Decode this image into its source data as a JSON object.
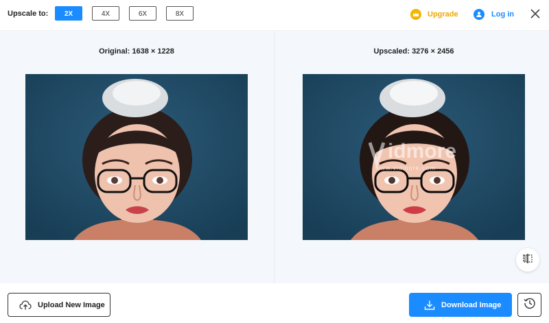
{
  "header": {
    "upscale_label": "Upscale to:",
    "scale_options": [
      "2X",
      "4X",
      "6X",
      "8X"
    ],
    "selected_scale": "2X",
    "upgrade_label": "Upgrade",
    "login_label": "Log in"
  },
  "preview": {
    "original_title": "Original: 1638 × 1228",
    "upscaled_title": "Upscaled: 3276 × 2456",
    "watermark_text": "idmore",
    "watermark_url": "www.vidmore.com"
  },
  "footer": {
    "upload_label": "Upload New Image",
    "download_label": "Download Image"
  },
  "icons": {
    "upgrade": "crown-icon",
    "login": "user-icon",
    "close": "close-icon",
    "compare": "compare-split-icon",
    "upload": "cloud-upload-icon",
    "download": "download-icon",
    "history": "history-icon"
  },
  "colors": {
    "accent": "#1a8cff",
    "upgrade": "#f0a500",
    "image_bg": "#1e4963"
  }
}
